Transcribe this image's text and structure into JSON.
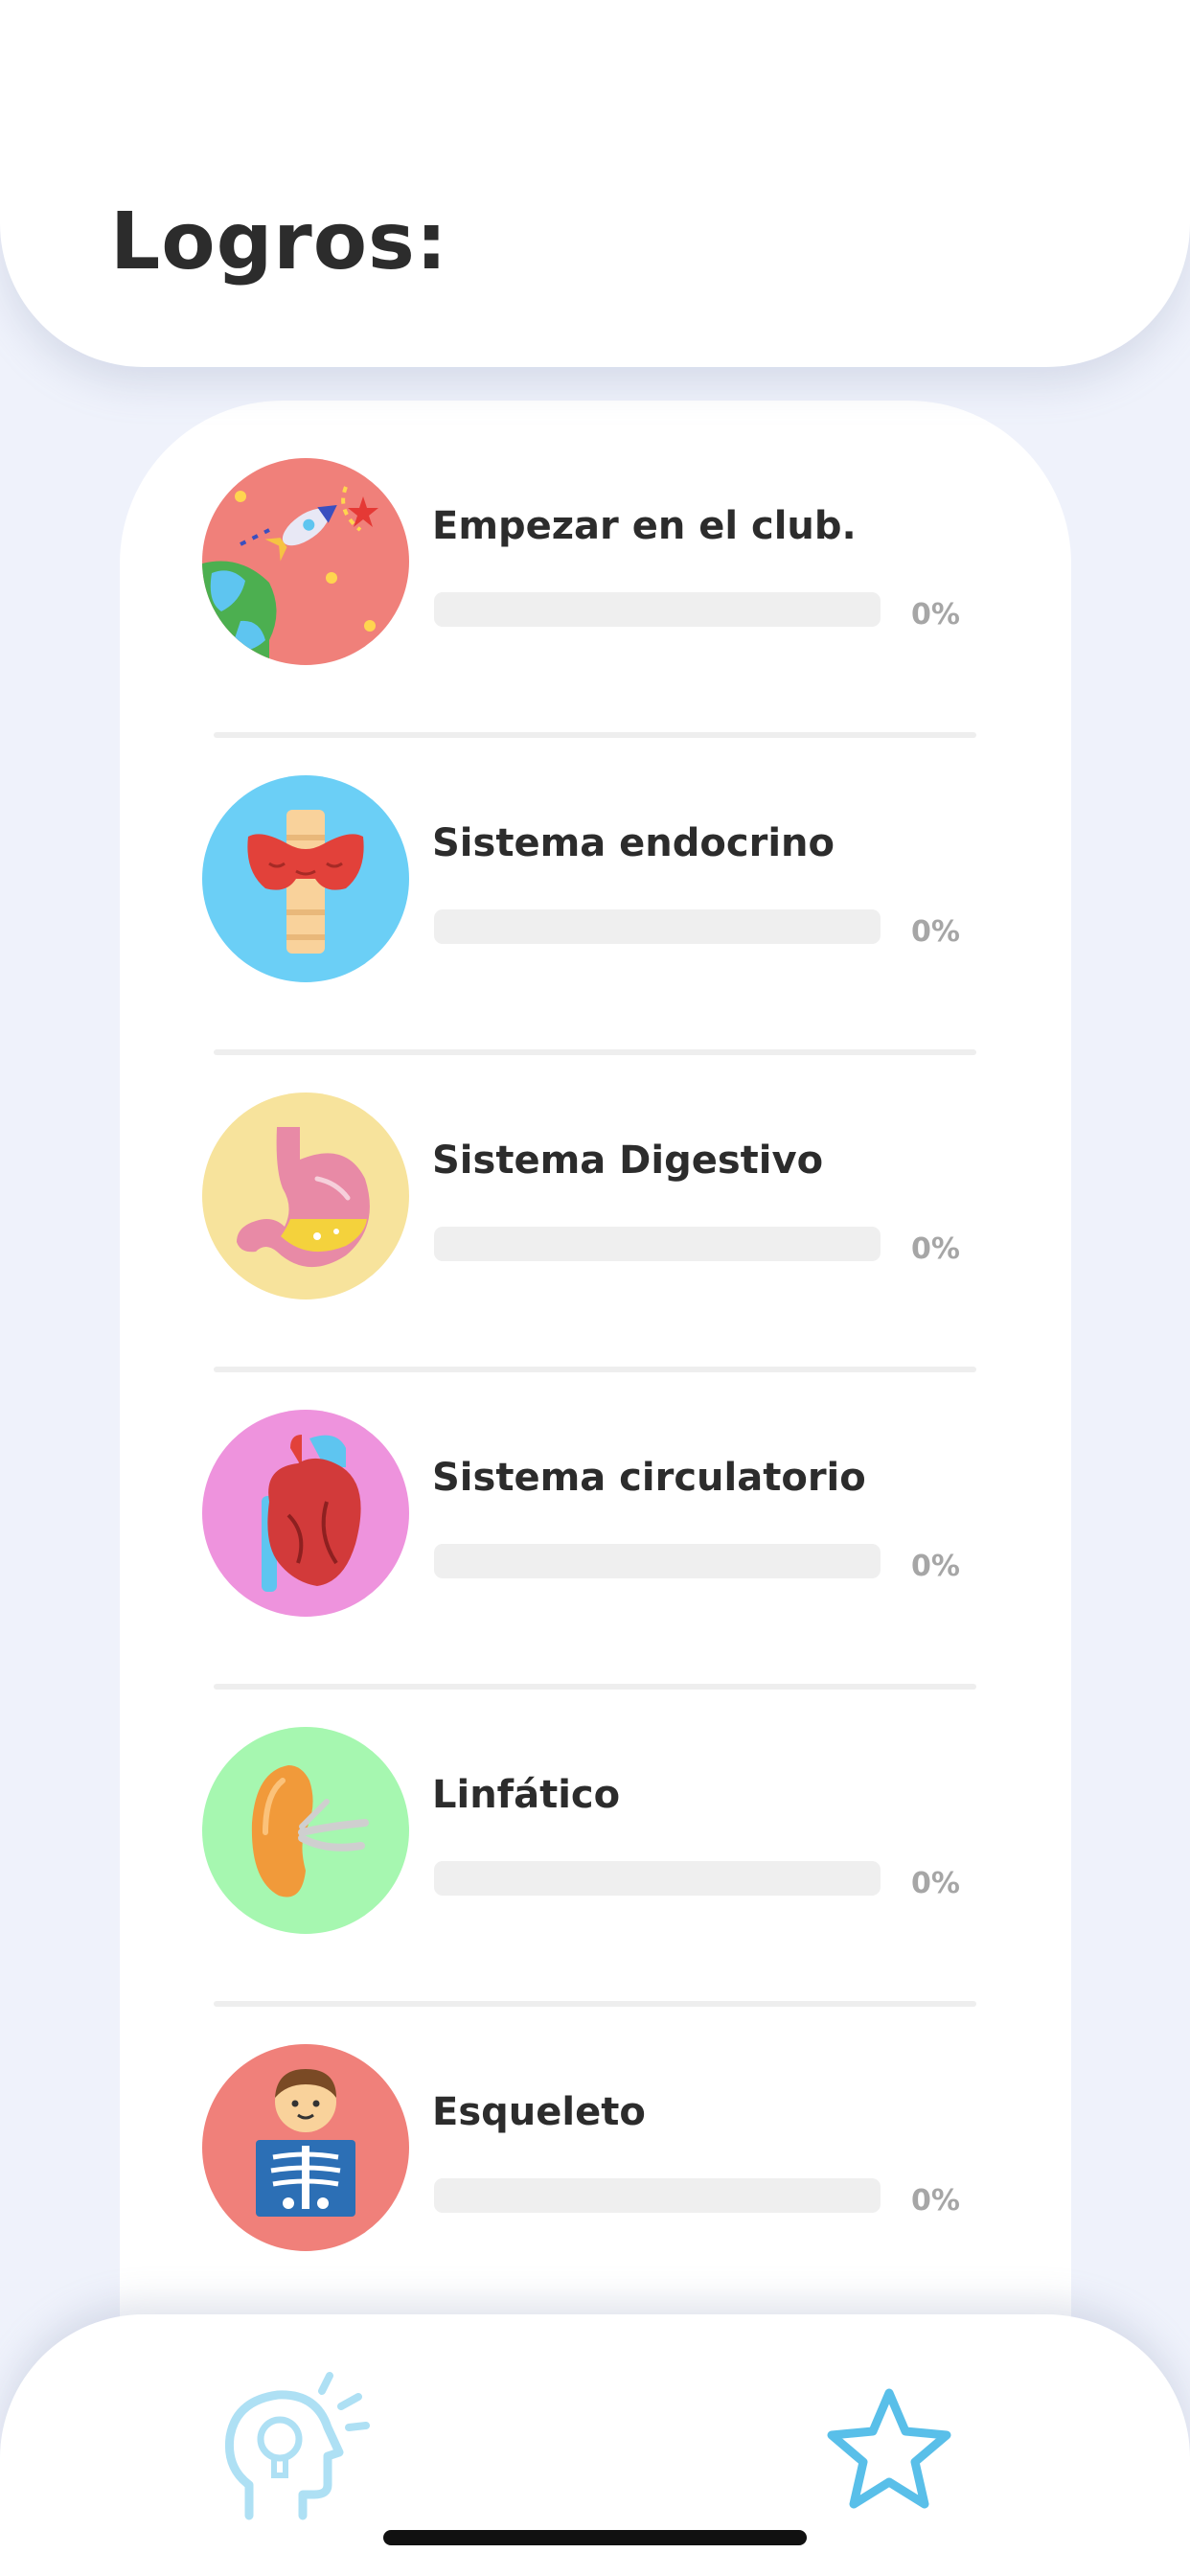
{
  "header": {
    "title": "Logros:"
  },
  "achievements": [
    {
      "label": "Empezar en el club.",
      "progress_percent": 0,
      "percent_text": "0%",
      "icon": "space-rocket-globe-icon",
      "badge_color": "#f0807a"
    },
    {
      "label": "Sistema endocrino",
      "progress_percent": 0,
      "percent_text": "0%",
      "icon": "thyroid-icon",
      "badge_color": "#6bcff6"
    },
    {
      "label": "Sistema Digestivo",
      "progress_percent": 0,
      "percent_text": "0%",
      "icon": "stomach-icon",
      "badge_color": "#f7e39c"
    },
    {
      "label": "Sistema circulatorio",
      "progress_percent": 0,
      "percent_text": "0%",
      "icon": "heart-icon",
      "badge_color": "#ee93dd"
    },
    {
      "label": "Linfático",
      "progress_percent": 0,
      "percent_text": "0%",
      "icon": "lymph-node-icon",
      "badge_color": "#a6f7b0"
    },
    {
      "label": "Esqueleto",
      "progress_percent": 0,
      "percent_text": "0%",
      "icon": "skeleton-xray-icon",
      "badge_color": "#f0807a"
    }
  ],
  "tabbar": {
    "tabs": [
      {
        "name": "learn",
        "icon": "head-idea-icon"
      },
      {
        "name": "achievements",
        "icon": "star-icon",
        "active": true
      }
    ],
    "icon_color": "#59bfe9"
  }
}
